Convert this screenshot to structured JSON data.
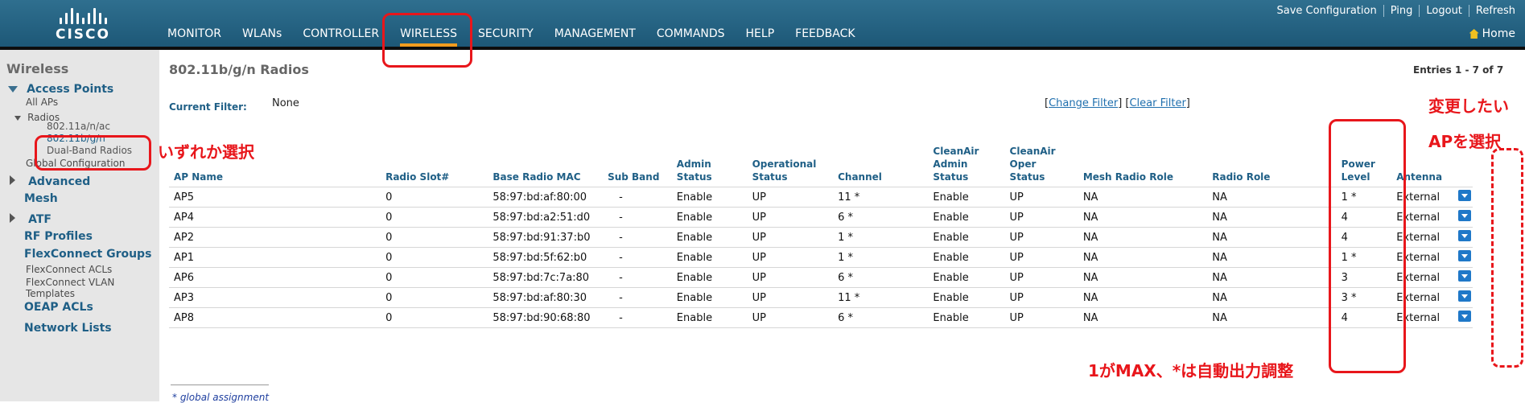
{
  "header": {
    "logo_text": "CISCO",
    "nav": [
      "MONITOR",
      "WLANs",
      "CONTROLLER",
      "WIRELESS",
      "SECURITY",
      "MANAGEMENT",
      "COMMANDS",
      "HELP",
      "FEEDBACK"
    ],
    "active_nav": "WIRELESS",
    "links": [
      "Save Configuration",
      "Ping",
      "Logout",
      "Refresh"
    ],
    "home_label": "Home"
  },
  "sidebar": {
    "title": "Wireless",
    "access_points": "Access Points",
    "all_aps": "All APs",
    "radios": "Radios",
    "radio_a": "802.11a/n/ac",
    "radio_b": "802.11b/g/n",
    "dual_band": "Dual-Band Radios",
    "global_config": "Global Configuration",
    "advanced": "Advanced",
    "mesh": "Mesh",
    "atf": "ATF",
    "rf_profiles": "RF Profiles",
    "flexconnect_groups": "FlexConnect Groups",
    "flexconnect_acls": "FlexConnect ACLs",
    "flexconnect_vlan_1": "FlexConnect VLAN",
    "flexconnect_vlan_2": "Templates",
    "oeap_acls": "OEAP ACLs",
    "network_lists": "Network Lists"
  },
  "main": {
    "title": "802.11b/g/n Radios",
    "entries": "Entries 1 - 7 of 7",
    "filter_label": "Current Filter:",
    "filter_value": "None",
    "change_filter": "Change Filter",
    "clear_filter": "Clear Filter",
    "columns": [
      "AP Name",
      "Radio Slot#",
      "Base Radio MAC",
      "Sub Band",
      "Admin Status",
      "Operational Status",
      "Channel",
      "CleanAir Admin Status",
      "CleanAir Oper Status",
      "Mesh Radio Role",
      "Radio Role",
      "Power Level",
      "Antenna"
    ],
    "rows": [
      [
        "AP5",
        "0",
        "58:97:bd:af:80:00",
        "-",
        "Enable",
        "UP",
        "11 *",
        "Enable",
        "UP",
        "NA",
        "NA",
        "1 *",
        "External"
      ],
      [
        "AP4",
        "0",
        "58:97:bd:a2:51:d0",
        "-",
        "Enable",
        "UP",
        "6 *",
        "Enable",
        "UP",
        "NA",
        "NA",
        "4",
        "External"
      ],
      [
        "AP2",
        "0",
        "58:97:bd:91:37:b0",
        "-",
        "Enable",
        "UP",
        "1 *",
        "Enable",
        "UP",
        "NA",
        "NA",
        "4",
        "External"
      ],
      [
        "AP1",
        "0",
        "58:97:bd:5f:62:b0",
        "-",
        "Enable",
        "UP",
        "1 *",
        "Enable",
        "UP",
        "NA",
        "NA",
        "1 *",
        "External"
      ],
      [
        "AP6",
        "0",
        "58:97:bd:7c:7a:80",
        "-",
        "Enable",
        "UP",
        "6 *",
        "Enable",
        "UP",
        "NA",
        "NA",
        "3",
        "External"
      ],
      [
        "AP3",
        "0",
        "58:97:bd:af:80:30",
        "-",
        "Enable",
        "UP",
        "11 *",
        "Enable",
        "UP",
        "NA",
        "NA",
        "3 *",
        "External"
      ],
      [
        "AP8",
        "0",
        "58:97:bd:90:68:80",
        "-",
        "Enable",
        "UP",
        "6 *",
        "Enable",
        "UP",
        "NA",
        "NA",
        "4",
        "External"
      ]
    ],
    "footnote": "* global assignment"
  },
  "annotations": {
    "select_either": "いずれか選択",
    "change_wanted": "変更したい",
    "select_ap": "APを選択",
    "power_note": "1がMAX、*は自動出力調整",
    "color": "#e8161b"
  }
}
